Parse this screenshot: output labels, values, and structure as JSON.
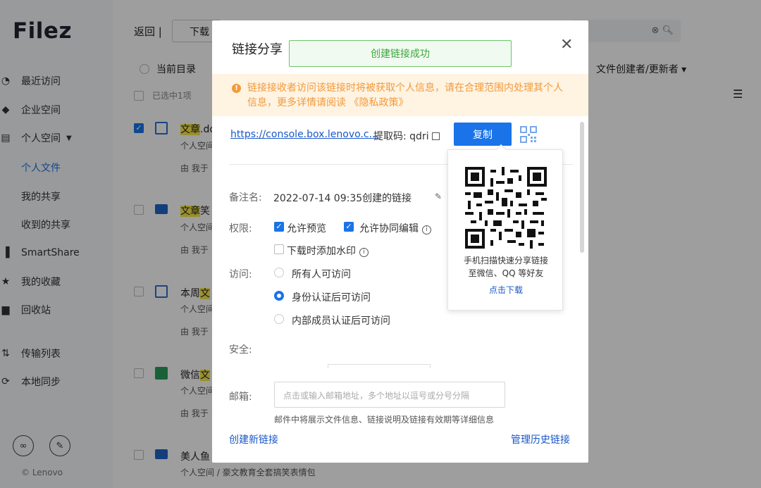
{
  "sidebar": {
    "logo": "Filez",
    "items": [
      {
        "label": "最近访问",
        "icon": "clock-icon"
      },
      {
        "label": "企业空间",
        "icon": "building-icon"
      },
      {
        "label": "个人空间",
        "icon": "personal-space-icon"
      },
      {
        "label": "SmartShare",
        "icon": "bar-chart-icon"
      },
      {
        "label": "我的收藏",
        "icon": "star-icon"
      },
      {
        "label": "回收站",
        "icon": "trash-icon"
      },
      {
        "label": "传输列表",
        "icon": "transfer-icon"
      },
      {
        "label": "本地同步",
        "icon": "sync-icon"
      }
    ],
    "sub_items": [
      {
        "label": "个人文件",
        "active": true
      },
      {
        "label": "我的共享",
        "active": false
      },
      {
        "label": "收到的共享",
        "active": false
      }
    ],
    "copyright": "© Lenovo"
  },
  "toolbar": {
    "back_label": "返回",
    "separator": "|",
    "download_label": "下载"
  },
  "list": {
    "current_dir_label": "当前目录",
    "selected_label": "已选中1项",
    "creator_header": "文件创建者/更新者",
    "rows": [
      {
        "name_hl": "文章",
        "name_rest": ".do",
        "path": "个人空间",
        "by": "由 我于",
        "checked": true,
        "icon_color": "#2b6fd6"
      },
      {
        "name_hl": "文章",
        "name_rest": "笑",
        "path": "个人空间",
        "by": "由 我于",
        "checked": false,
        "icon_color": "#1d64c8"
      },
      {
        "name_pre": "本周",
        "name_hl": "文",
        "path": "个人空间",
        "by": "由 我于",
        "checked": false,
        "icon_color": "#2b6fd6"
      },
      {
        "name_pre": "微信",
        "name_hl": "文",
        "path": "个人空间",
        "by": "由 我于",
        "checked": false,
        "icon_color": "#2a9d5c"
      },
      {
        "name_pre": "美人鱼",
        "path": "个人空间 / 豪文教育全套搞笑表情包",
        "checked": false,
        "icon_color": "#1d64c8"
      }
    ]
  },
  "dialog": {
    "title": "链接分享",
    "toast": "创建链接成功",
    "warning_line1": "链接接收者访问该链接时将被获取个人信息，请在合理范围内处理其个人",
    "warning_line2": "信息，更多详情请阅读 《隐私政策》",
    "link_url": "https://console.box.lenovo.c...",
    "code_label": "提取码: qdri",
    "copy_button": "复制",
    "note_label": "备注名:",
    "note_value": "2022-07-14 09:35创建的链接",
    "permission_label": "权限:",
    "permissions": [
      {
        "label": "允许预览",
        "checked": true
      },
      {
        "label": "允许协同编辑",
        "checked": true
      },
      {
        "label": "下载时添加水印",
        "checked": false
      }
    ],
    "access_label": "访问:",
    "access_options": [
      {
        "label": "所有人可访问",
        "selected": false
      },
      {
        "label": "身份认证后可访问",
        "selected": true
      },
      {
        "label": "内部成员认证后可访问",
        "selected": false
      }
    ],
    "security_label": "安全:",
    "email_label": "邮箱:",
    "email_placeholder": "点击或输入邮箱地址，多个地址以逗号或分号分隔",
    "email_hint": "邮件中将展示文件信息、链接说明及链接有效期等详细信息",
    "create_new_link": "创建新链接",
    "manage_history": "管理历史链接",
    "qr_popover": {
      "line1": "手机扫描快速分享链接",
      "line2": "至微信、QQ 等好友",
      "download": "点击下载"
    }
  },
  "colors": {
    "primary": "#1a73e8",
    "link": "#1a57c9",
    "warning": "#f29a3a",
    "success": "#3ea63e",
    "highlight": "#f7e84a"
  }
}
